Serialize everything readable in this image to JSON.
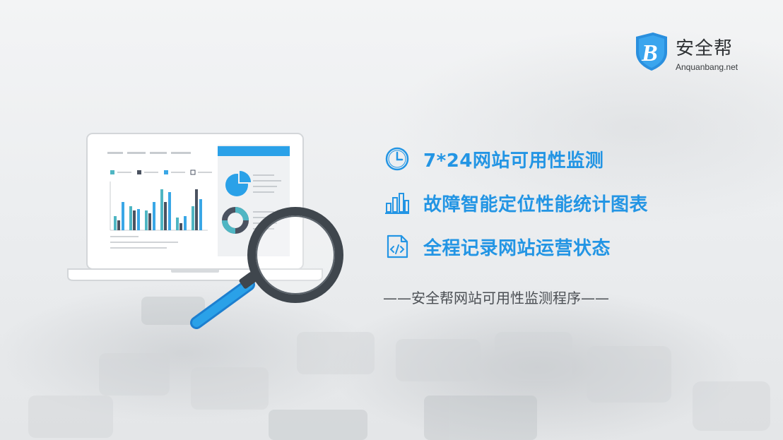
{
  "logo": {
    "name": "安全帮",
    "url": "Anquanbang.net",
    "mark_letter": "B"
  },
  "colors": {
    "accent": "#2395e4",
    "accent_dark": "#1d7fcf",
    "magnifier_rim": "#3f464d",
    "chart_teal": "#4fb6c3",
    "chart_blue": "#3aa7e6",
    "chart_dark": "#4a5260"
  },
  "features": [
    {
      "icon": "clock-icon",
      "text": "7*24网站可用性监测"
    },
    {
      "icon": "bar-chart-icon",
      "text": "故障智能定位性能统计图表"
    },
    {
      "icon": "code-file-icon",
      "text": "全程记录网站运营状态"
    }
  ],
  "tagline": "——安全帮网站可用性监测程序——"
}
